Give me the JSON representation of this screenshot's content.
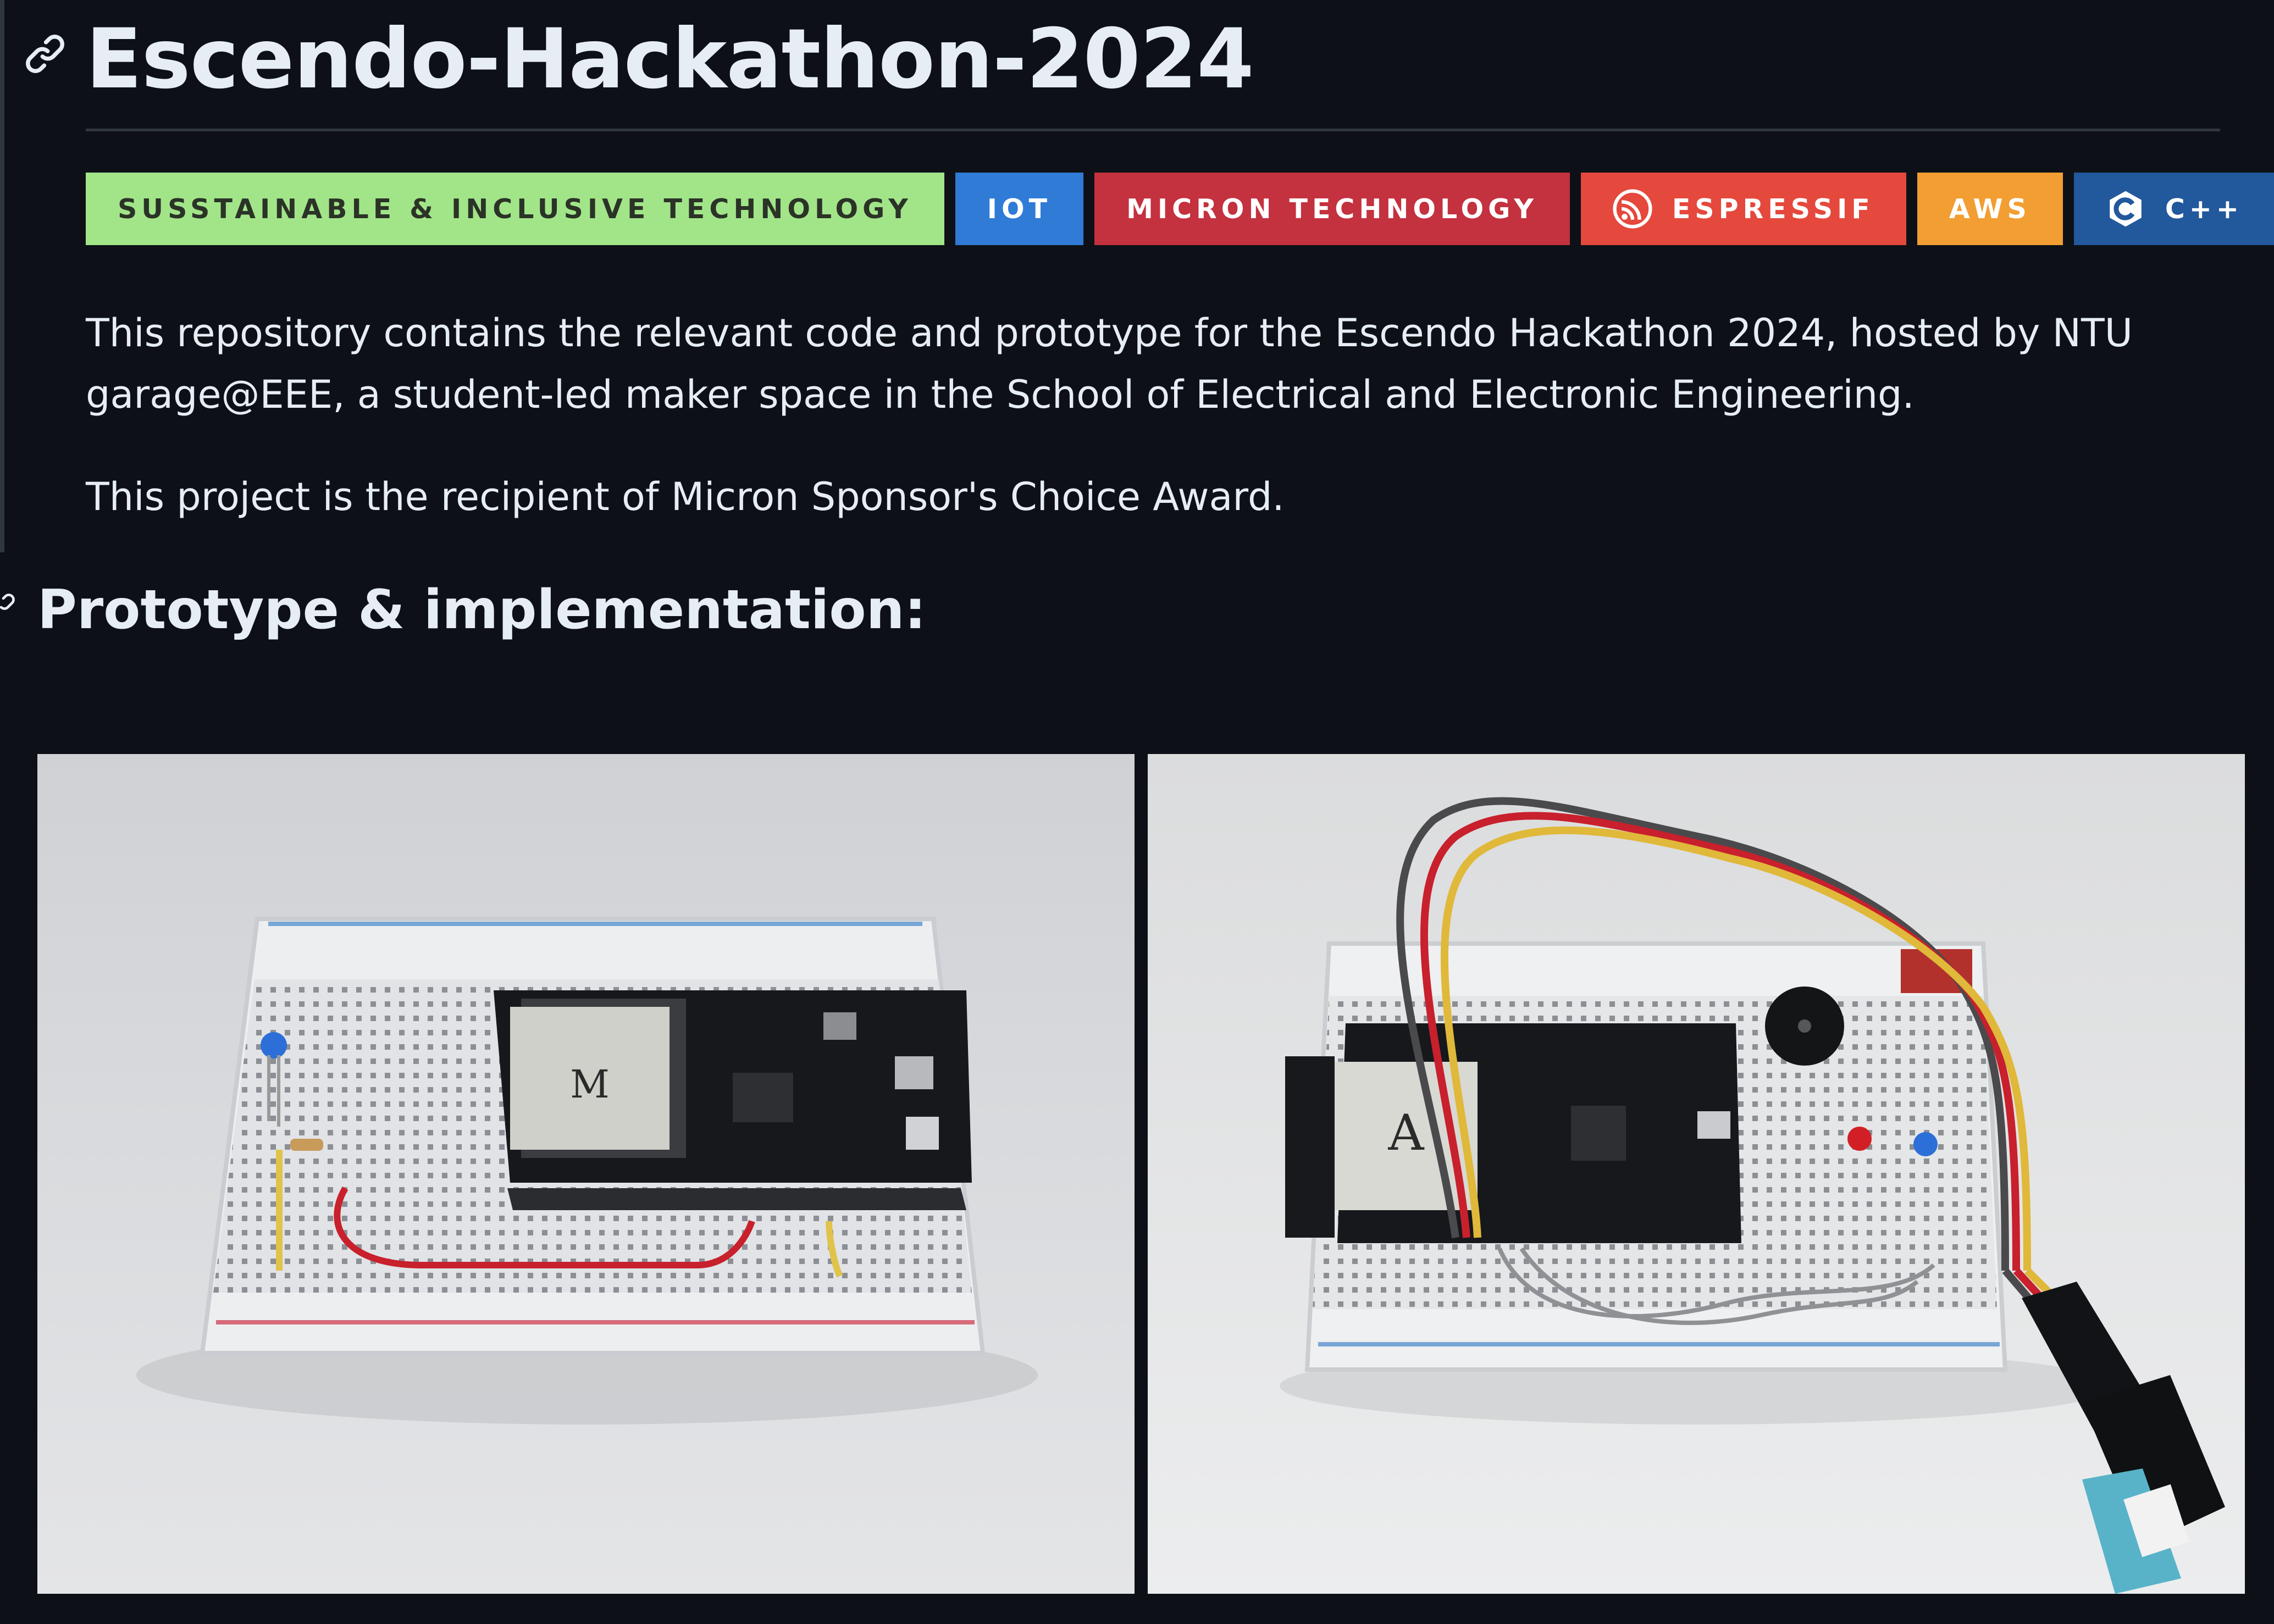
{
  "readme": {
    "title": "Escendo-Hackathon-2024",
    "badges": [
      {
        "label": "SUSSTAINABLE & INCLUSIVE TECHNOLOGY",
        "bg": "#a2e589",
        "fg": "#2b3327",
        "icon": ""
      },
      {
        "label": "IOT",
        "bg": "#2f7bd6",
        "fg": "#ffffff",
        "icon": ""
      },
      {
        "label": "MICRON TECHNOLOGY",
        "bg": "#c4313f",
        "fg": "#ffffff",
        "icon": ""
      },
      {
        "label": "ESPRESSIF",
        "bg": "#e5483c",
        "fg": "#ffffff",
        "icon": "espressif-logo-icon"
      },
      {
        "label": "AWS",
        "bg": "#f29e32",
        "fg": "#ffffff",
        "icon": ""
      },
      {
        "label": "C++",
        "bg": "#22589c",
        "fg": "#ffffff",
        "icon": "cpp-logo-icon"
      }
    ],
    "intro_line_1": "This repository contains the relevant code and prototype for the Escendo Hackathon 2024, hosted by NTU",
    "intro_line_2": "garage@EEE, a student-led maker space in the School of Electrical and Electronic Engineering.",
    "award_text": "This project is the recipient of Micron Sponsor's Choice Award.",
    "section_heading": "Prototype & implementation:",
    "photos": [
      {
        "module_label": "M"
      },
      {
        "module_label": "A"
      }
    ]
  },
  "theme": {
    "background": "#0d1117",
    "text": "#e6edf3",
    "rule": "#30363d"
  }
}
